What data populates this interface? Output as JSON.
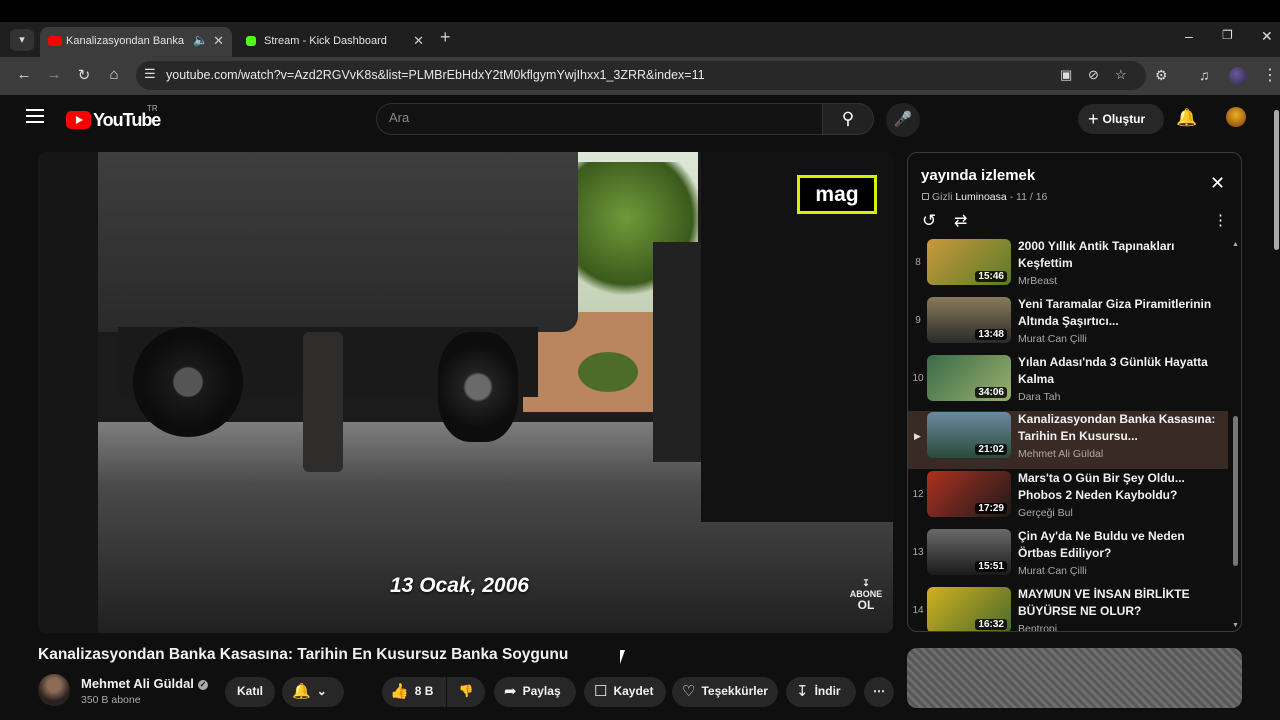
{
  "browser": {
    "tabs": [
      {
        "title": "Kanalizasyondan Banka Kasası",
        "active": true,
        "favicon_color": "#ff0000",
        "audio": true
      },
      {
        "title": "Stream - Kick Dashboard",
        "active": false,
        "favicon_color": "#53fc18"
      }
    ],
    "url": "youtube.com/watch?v=Azd2RGVvK8s&list=PLMBrEbHdxY2tM0kflgymYwjIhxx1_3ZRR&index=11"
  },
  "yt": {
    "logo_text": "YouTube",
    "country_code": "TR",
    "search_placeholder": "Ara",
    "create_label": "Oluştur"
  },
  "player": {
    "overlay_logo": "mag",
    "caption": "13 Ocak, 2006",
    "subscribe_badge_line1": "ABONE",
    "subscribe_badge_line2": "OL"
  },
  "video": {
    "title": "Kanalizasyondan Banka Kasasına: Tarihin En Kusursuz Banka Soygunu",
    "channel": "Mehmet Ali Güldal",
    "subscribers": "350 B abone",
    "join_label": "Katıl",
    "likes": "8 B",
    "share_label": "Paylaş",
    "save_label": "Kaydet",
    "thanks_label": "Teşekkürler",
    "download_label": "İndir"
  },
  "playlist": {
    "title": "yayında izlemek",
    "privacy": "Gizli",
    "owner": "Luminoasa",
    "position": "- 11 / 16",
    "items": [
      {
        "index": "8",
        "title": "2000 Yıllık Antik Tapınakları Keşfettim",
        "channel": "MrBeast",
        "duration": "15:46",
        "thumb_colors": [
          "#c89a3a",
          "#5a7a2a"
        ]
      },
      {
        "index": "9",
        "title": "Yeni Taramalar Giza Piramitlerinin Altında Şaşırtıcı...",
        "channel": "Murat Can Çilli",
        "duration": "13:48",
        "thumb_colors": [
          "#8a7a5a",
          "#2a2a2a"
        ]
      },
      {
        "index": "10",
        "title": "Yılan Adası'nda 3 Günlük Hayatta Kalma",
        "channel": "Dara Tah",
        "duration": "34:06",
        "thumb_colors": [
          "#3a6a4a",
          "#9ab06a"
        ]
      },
      {
        "index": "",
        "title": "Kanalizasyondan Banka Kasasına: Tarihin En Kusursu...",
        "channel": "Mehmet Ali Güldal",
        "duration": "21:02",
        "thumb_colors": [
          "#6a8aa0",
          "#2a4a3a"
        ],
        "current": true
      },
      {
        "index": "12",
        "title": "Mars'ta O Gün Bir Şey Oldu... Phobos 2 Neden Kayboldu?",
        "channel": "Gerçeği Bul",
        "duration": "17:29",
        "thumb_colors": [
          "#b03020",
          "#1a1a1a"
        ]
      },
      {
        "index": "13",
        "title": "Çin Ay'da Ne Buldu ve Neden Örtbas Ediliyor?",
        "channel": "Murat Can Çilli",
        "duration": "15:51",
        "thumb_colors": [
          "#6a6a6a",
          "#1a1a1a"
        ]
      },
      {
        "index": "14",
        "title": "MAYMUN VE İNSAN BİRLİKTE BÜYÜRSE NE OLUR?",
        "channel": "Bentropi",
        "duration": "16:32",
        "thumb_colors": [
          "#d0b020",
          "#4a6a2a"
        ]
      }
    ]
  }
}
